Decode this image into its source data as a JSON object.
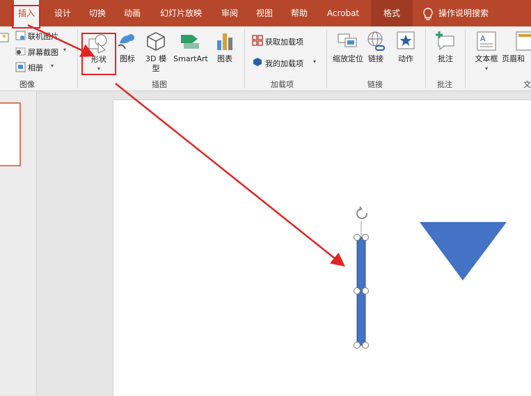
{
  "tabs": [
    "插入",
    "设计",
    "切换",
    "动画",
    "幻灯片放映",
    "审阅",
    "视图",
    "帮助",
    "Acrobat",
    "格式"
  ],
  "tell_me": "操作说明搜索",
  "ribbon": {
    "image_group": {
      "items": [
        "联机图片",
        "屏幕截图",
        "相册"
      ],
      "label": "图像"
    },
    "illustrations": {
      "shape": "形状",
      "icon": "图标",
      "model3d": "3D 模型",
      "smartart": "SmartArt",
      "chart": "图表",
      "label": "插图"
    },
    "addins": {
      "get": "获取加载项",
      "mine": "我的加载项",
      "label": "加载项"
    },
    "links": {
      "zoom": "缩放定位",
      "link": "链接",
      "action": "动作",
      "label": "链接"
    },
    "comments": {
      "comment": "批注",
      "label": "批注"
    },
    "text": {
      "textbox": "文本框",
      "header": "页眉和",
      "label": "文"
    }
  },
  "colors": {
    "accent": "#b7472a",
    "shape_fill": "#4472c4",
    "annotation": "#e02424"
  },
  "icons": [
    "picture-icon",
    "online-picture-icon",
    "screenshot-icon",
    "album-icon",
    "shapes-icon",
    "icons-icon",
    "3d-model-icon",
    "smartart-icon",
    "chart-icon",
    "store-icon",
    "my-addins-icon",
    "zoom-icon",
    "link-icon",
    "action-icon",
    "comment-icon",
    "textbox-icon",
    "header-icon",
    "lightbulb-icon",
    "rotate-handle-icon"
  ]
}
